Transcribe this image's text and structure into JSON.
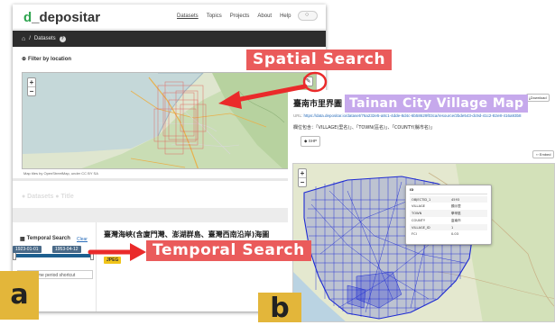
{
  "brand": {
    "logo_mark": "d",
    "name": "_depositar"
  },
  "nav": [
    "Datasets",
    "Topics",
    "Projects",
    "About",
    "Help"
  ],
  "breadcrumb": {
    "label": "Datasets",
    "help": "?"
  },
  "filter": {
    "title": "Filter by location",
    "attribution": "Map tiles by OpenStreetMap, under CC BY SA"
  },
  "below_map_faded": "● Datasets ● Title",
  "temporal": {
    "title": "Temporal Search",
    "clear": "Clear",
    "start": "1923-01-01",
    "end": "1953-04-12",
    "shortcut": "Or use time period shortcut"
  },
  "dataset_a": {
    "title": "臺灣海峽(含廈門灣、澎湖群島、臺灣西南沿岸)海圖",
    "format": "JPEG"
  },
  "annotations": {
    "spatial": "Spatial Search",
    "temporal": "Temporal Search",
    "village": "Tainan City Village Map"
  },
  "panels": {
    "a": "a",
    "b": "b"
  },
  "record": {
    "title": "臺南市里界圖",
    "download": "Download",
    "url_label": "URL:",
    "url": "https://data.depositar.io/dataset/76a232e5-a8c1-4dde-8d4c-6b58629f03ca/resource/2bde543-dc9d-41c2-82e8-416a93b8",
    "fields_label": "欄位包含：",
    "fields": "「VILLAGE(里名)」、「TOWN(區名)」、「COUNTY(縣市名)」",
    "format": "SHP",
    "embed": "Embed"
  },
  "popup": {
    "title": "ID",
    "rows": [
      [
        "OBJECTID_1",
        "4593"
      ],
      [
        "VILLAGE",
        "顯示里"
      ],
      [
        "TOWN",
        "學甲區"
      ],
      [
        "COUNTY",
        "臺南市"
      ],
      [
        "VILLAGE_ID",
        "1"
      ],
      [
        "FCI",
        "0.03"
      ]
    ]
  },
  "colors": {
    "brand": "#2ea44f",
    "accent_red": "#ea2a2a",
    "tag_bg": "#ea5b5b",
    "village_tag": "#c6a9ec",
    "panel_letter": "#e3b63a",
    "boundaries": "#1e2bd3",
    "highlight": "#f1e030",
    "dark_bar": "#2d2d2d",
    "bbox_red": "#e0605a"
  }
}
